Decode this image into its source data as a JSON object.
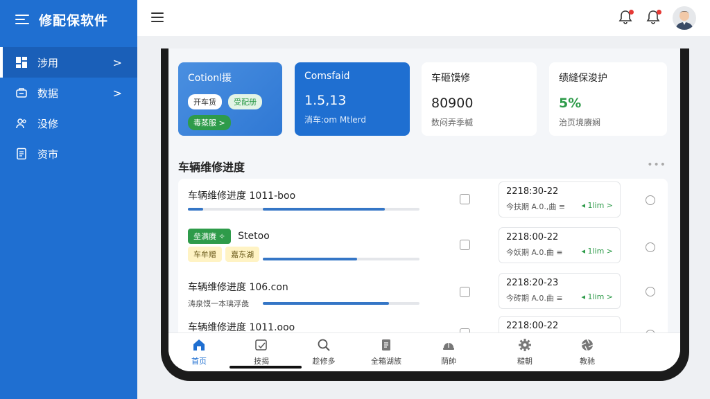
{
  "app": {
    "title": "修配保软件"
  },
  "sidebar": {
    "items": [
      {
        "label": "涉用",
        "icon": "dashboard-icon",
        "active": true,
        "chevron": ">"
      },
      {
        "label": "数据",
        "icon": "briefcase-icon",
        "active": false,
        "chevron": ">"
      },
      {
        "label": "没修",
        "icon": "users-icon",
        "active": false
      },
      {
        "label": "资市",
        "icon": "document-icon",
        "active": false
      }
    ]
  },
  "stats": [
    {
      "label": "Cotionl援",
      "pills": [
        "开车赁",
        "受配册",
        "毒蒸服 >"
      ]
    },
    {
      "label": "Comsfaid",
      "value": "1.5,13",
      "sub": "消车:om Mtlerd"
    },
    {
      "label": "车砸馍修",
      "value": "80900",
      "sub": "数闷弄季槭"
    },
    {
      "label": "绩縫保浚护",
      "value": "5%",
      "sub": "治页境赓娴"
    }
  ],
  "section": {
    "title": "车辆维修进度",
    "more": "•••"
  },
  "rows": [
    {
      "name": "车辆维修进度 1011-boo",
      "date": "2218:30-22",
      "meta_left": "今扶期 A.0.,曲 ≡",
      "meta_right": "◂ 1lim >",
      "progress_a": 0.06,
      "progress_b": 0.53
    },
    {
      "name": "Stetoo",
      "pill1": "垒满赓 ✧",
      "pill2": "车牟赠",
      "pill3": "嘉东湖",
      "date": "2218:00-22",
      "meta_left": "今妖期 A.0.曲 ≡",
      "meta_right": "◂ 1lim >",
      "progress": 0.41
    },
    {
      "name": "车辆维修进度 106.con",
      "subtext": "涛泉馍一本璃浮彘",
      "date": "2218:20-23",
      "meta_left": "今砖期 A.0.曲 ≡",
      "meta_right": "◂ 1lim >",
      "progress": 0.55
    },
    {
      "name": "车辆维修进度 1011.ooo",
      "date": "2218:00-22"
    }
  ],
  "tabs": [
    {
      "label": "首页",
      "icon": "home-icon",
      "active": true
    },
    {
      "label": "技揭",
      "icon": "edit-icon",
      "active": false
    },
    {
      "label": "趁修多",
      "icon": "search-icon",
      "active": false
    },
    {
      "label": "全箱湖族",
      "icon": "clipboard-icon",
      "active": false
    },
    {
      "label": "荫帥",
      "icon": "helmet-icon",
      "active": false
    },
    {
      "label": "糙朝",
      "icon": "gear-icon",
      "active": false
    },
    {
      "label": "教驰",
      "icon": "aperture-icon",
      "active": false
    }
  ],
  "colors": {
    "primary": "#1f6fd1",
    "success": "#2e9b4a",
    "warning": "#fff3c4"
  }
}
